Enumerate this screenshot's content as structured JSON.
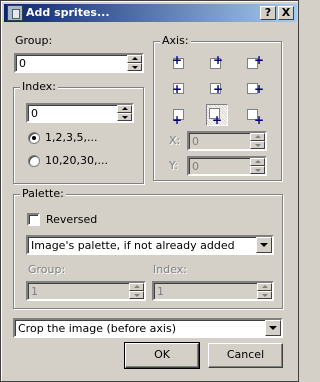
{
  "window": {
    "title": "Add sprites...",
    "help_button": "?",
    "close_button": "X"
  },
  "group": {
    "label": "Group:",
    "value": "0"
  },
  "index": {
    "legend": "Index:",
    "value": "0",
    "options": [
      "1,2,3,5,...",
      "10,20,30,..."
    ],
    "selected_option": 0
  },
  "axis": {
    "legend": "Axis:",
    "positions": [
      "top-left",
      "top-center",
      "top-right",
      "middle-left",
      "center",
      "middle-right",
      "bottom-left",
      "bottom-center",
      "bottom-right"
    ],
    "selected": "bottom-center",
    "x_label": "X:",
    "x_value": "0",
    "y_label": "Y:",
    "y_value": "0"
  },
  "palette": {
    "legend": "Palette:",
    "reversed_label": "Reversed",
    "reversed_checked": false,
    "source_value": "Image's palette, if not already added",
    "group_label": "Group:",
    "group_value": "1",
    "index_label": "Index:",
    "index_value": "1"
  },
  "crop": {
    "value": "Crop the image (before axis)"
  },
  "buttons": {
    "ok": "OK",
    "cancel": "Cancel"
  },
  "colors": {
    "titlebar_start": "#0a246a",
    "titlebar_end": "#a6caf0",
    "face": "#d4d0c8",
    "plus": "#000080"
  }
}
